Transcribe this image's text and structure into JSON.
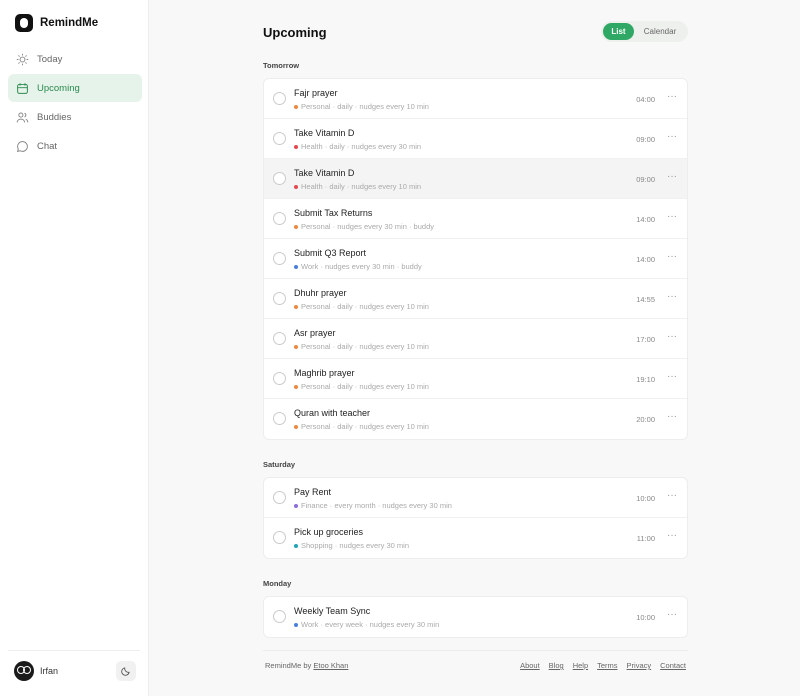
{
  "app": {
    "name": "RemindMe"
  },
  "sidebar": {
    "items": [
      {
        "label": "Today",
        "icon": "sun-icon"
      },
      {
        "label": "Upcoming",
        "icon": "calendar-icon",
        "active": true
      },
      {
        "label": "Buddies",
        "icon": "users-icon"
      },
      {
        "label": "Chat",
        "icon": "chat-bubble-icon"
      }
    ],
    "user": {
      "name": "Irfan"
    }
  },
  "main": {
    "title": "Upcoming",
    "view_toggle": {
      "list": "List",
      "calendar": "Calendar",
      "selected": "List"
    },
    "sections": [
      {
        "label": "Tomorrow",
        "items": [
          {
            "title": "Fajr prayer",
            "meta": "Personal · daily · nudges every 10 min",
            "time": "04:00",
            "color": "#f0883e"
          },
          {
            "title": "Take Vitamin D",
            "meta": "Health · daily · nudges every 30 min",
            "time": "09:00",
            "color": "#e5484d"
          },
          {
            "title": "Take Vitamin D",
            "meta": "Health · daily · nudges every 10 min",
            "time": "09:00",
            "color": "#e5484d"
          },
          {
            "title": "Submit Tax Returns",
            "meta": "Personal · nudges every 30 min · buddy",
            "time": "14:00",
            "color": "#f0883e"
          },
          {
            "title": "Submit Q3 Report",
            "meta": "Work · nudges every 30 min · buddy",
            "time": "14:00",
            "color": "#4a7fe0"
          },
          {
            "title": "Dhuhr prayer",
            "meta": "Personal · daily · nudges every 10 min",
            "time": "14:55",
            "color": "#f0883e"
          },
          {
            "title": "Asr prayer",
            "meta": "Personal · daily · nudges every 10 min",
            "time": "17:00",
            "color": "#f0883e"
          },
          {
            "title": "Maghrib prayer",
            "meta": "Personal · daily · nudges every 10 min",
            "time": "19:10",
            "color": "#f0883e"
          },
          {
            "title": "Quran with teacher",
            "meta": "Personal · daily · nudges every 10 min",
            "time": "20:00",
            "color": "#f0883e"
          }
        ]
      },
      {
        "label": "Saturday",
        "items": [
          {
            "title": "Pay Rent",
            "meta": "Finance · every month · nudges every 30 min",
            "time": "10:00",
            "color": "#8b6ee0"
          },
          {
            "title": "Pick up groceries",
            "meta": "Shopping · nudges every 30 min",
            "time": "11:00",
            "color": "#20a4b8"
          }
        ]
      },
      {
        "label": "Monday",
        "items": [
          {
            "title": "Weekly Team Sync",
            "meta": "Work · every week · nudges every 30 min",
            "time": "10:00",
            "color": "#4a7fe0"
          }
        ]
      }
    ]
  },
  "footer": {
    "credit_prefix": "RemindMe by",
    "credit_author": "Etoo Khan",
    "links": [
      "About",
      "Blog",
      "Help",
      "Terms",
      "Privacy",
      "Contact"
    ]
  }
}
